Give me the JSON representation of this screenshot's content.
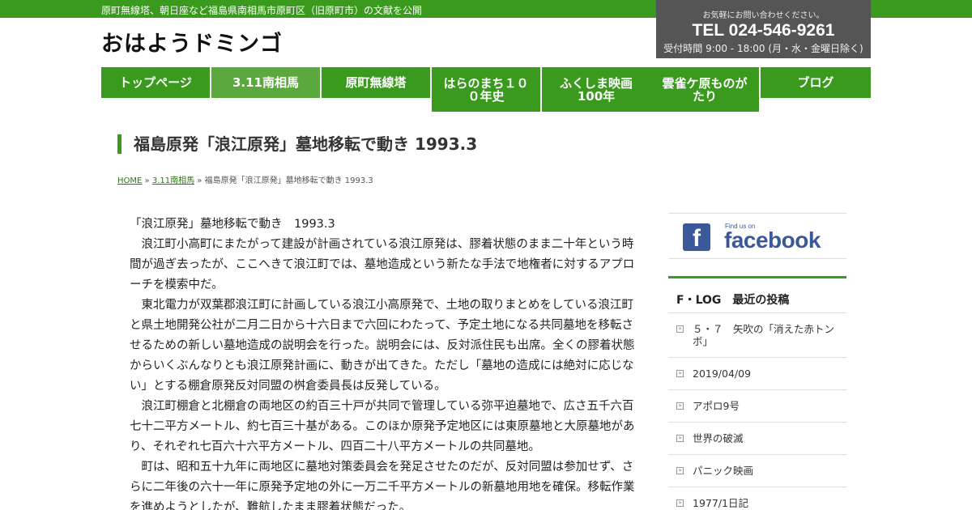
{
  "topbar": {
    "text": "原町無線塔、朝日座など福島県南相馬市原町区（旧原町市）の文献を公開"
  },
  "site": {
    "title": "おはようドミンゴ"
  },
  "contact": {
    "note": "お気軽にお問い合わせください。",
    "tel": "TEL 024-546-9261",
    "hours": "受付時間 9:00 - 18:00 (月・水・金曜日除く)"
  },
  "nav": {
    "items": [
      {
        "label": "トップページ"
      },
      {
        "label": "3.11南相馬"
      },
      {
        "label": "原町無線塔"
      },
      {
        "label": "はらのまち１００年史"
      },
      {
        "label": "ふくしま映画100年"
      },
      {
        "label": "雲雀ケ原ものがたり"
      },
      {
        "label": "ブログ"
      }
    ]
  },
  "post": {
    "title": "福島原発「浪江原発」墓地移転で動き 1993.3"
  },
  "breadcrumb": {
    "home": "HOME",
    "sep": " » ",
    "category": "3.11南相馬",
    "current": "福島原発「浪江原発」墓地移転で動き 1993.3"
  },
  "article": {
    "paragraphs": [
      "「浪江原発」墓地移転で動き　1993.3",
      "　浪江町小高町にまたがって建設が計画されている浪江原発は、膠着状態のまま二十年という時間が過ぎ去ったが、ここへきて浪江町では、墓地造成という新たな手法で地権者に対するアプローチを模索中だ。",
      "　東北電力が双葉郡浪江町に計画している浪江小高原発で、土地の取りまとめをしている浪江町と県土地開発公社が二月二日から十六日まで六回にわたって、予定土地になる共同墓地を移転させるための新しい墓地造成の説明会を行った。説明会には、反対派住民も出席。全くの膠着状態からいくぶんなりとも浪江原発計画に、動きが出てきた。ただし「墓地の造成には絶対に応じない」とする棚倉原発反対同盟の桝倉委員長は反発している。",
      "　浪江町棚倉と北棚倉の両地区の約百三十戸が共同で管理している弥平迫墓地で、広さ五千六百七十二平方メートル、約七百三十基がある。このほか原発予定地区には東原墓地と大原墓地があり、それぞれ七百六十六平方メートル、四百二十八平方メートルの共同墓地。",
      "　町は、昭和五十九年に両地区に墓地対策委員会を発足させたのだが、反対同盟は参加せず、さらに二年後の六十一年に原発予定地の外に一万二千平方メートルの新墓地用地を確保。移転作業を進めようとしたが、難航したまま膠着状態だった。"
    ]
  },
  "sidebar": {
    "facebook": {
      "findus": "Find us on",
      "word": "facebook",
      "glyph": "f"
    },
    "recent_title": "F・LOG　最近の投稿",
    "bullet": "»",
    "recent": [
      "５・７　矢吹の「消えた赤トンボ」",
      "2019/04/09",
      "アポロ9号",
      "世界の破滅",
      "パニック映画",
      "1977/1日記"
    ]
  },
  "colors": {
    "brand_green": "#3a9a1e",
    "nav_active": "#5ba83e",
    "contact_bg": "#555555",
    "facebook_blue": "#3b5998"
  }
}
